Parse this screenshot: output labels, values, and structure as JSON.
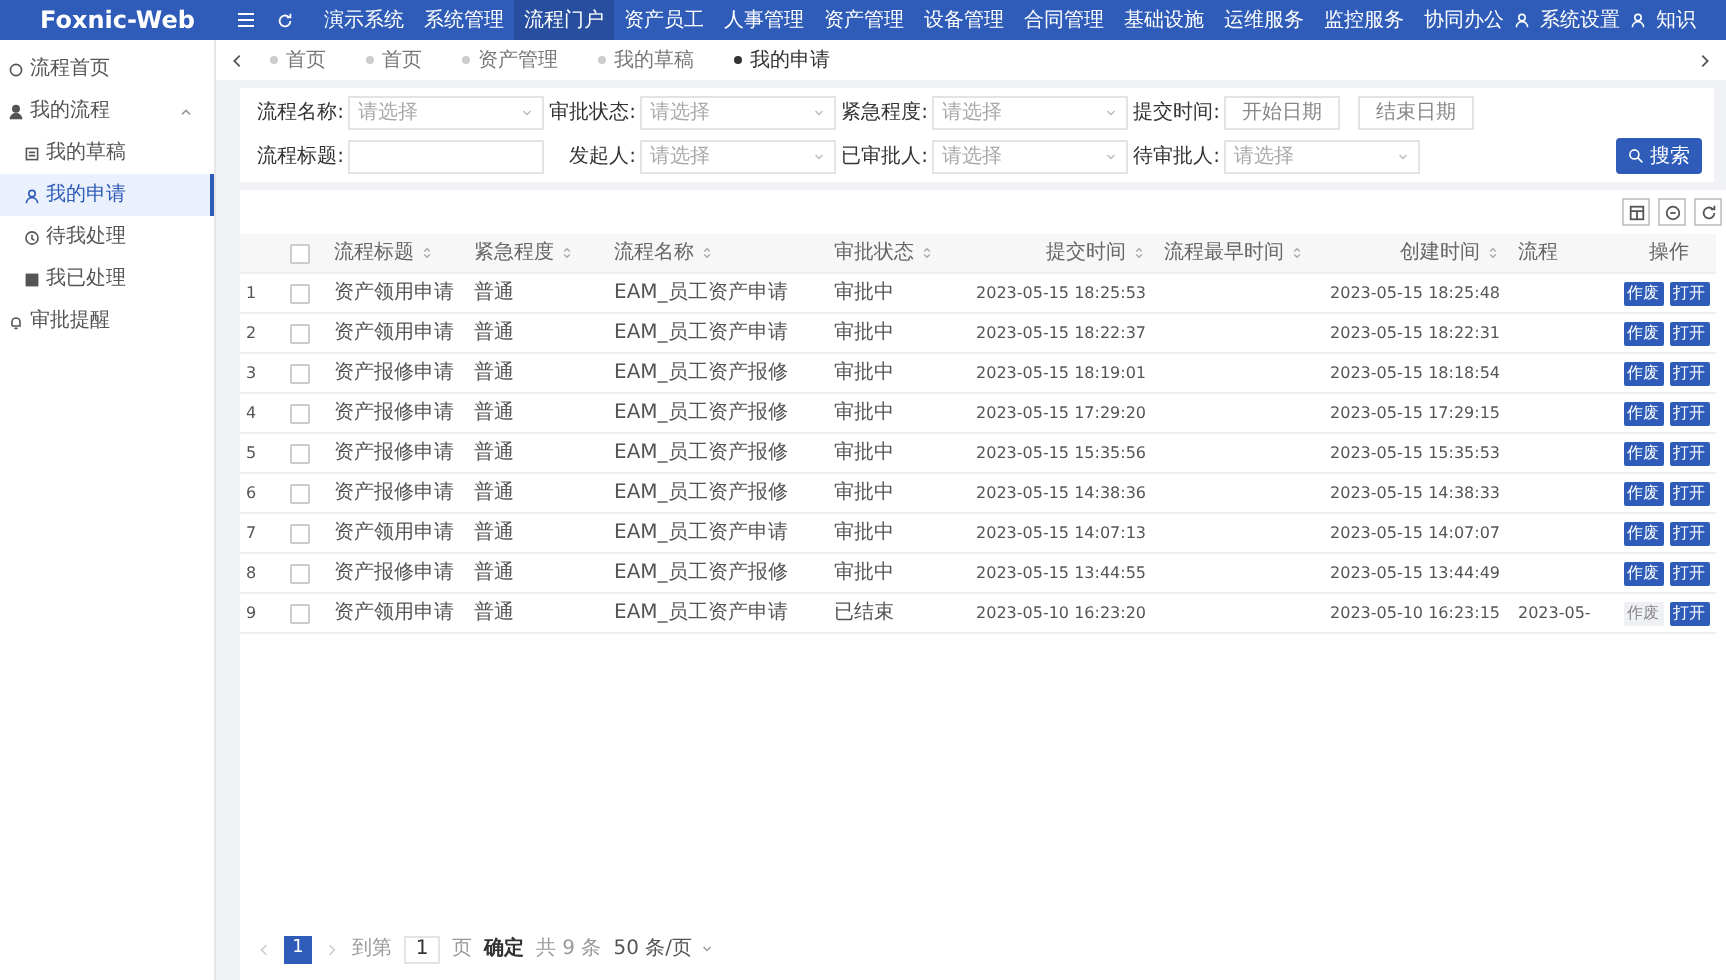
{
  "app": {
    "logo": "Foxnic-Web"
  },
  "nav": [
    {
      "label": "演示系统",
      "selected": false
    },
    {
      "label": "系统管理",
      "selected": false
    },
    {
      "label": "流程门户",
      "selected": true
    },
    {
      "label": "资产员工",
      "selected": false
    },
    {
      "label": "人事管理",
      "selected": false
    },
    {
      "label": "资产管理",
      "selected": false
    },
    {
      "label": "设备管理",
      "selected": false
    },
    {
      "label": "合同管理",
      "selected": false
    },
    {
      "label": "基础设施",
      "selected": false
    },
    {
      "label": "运维服务",
      "selected": false
    },
    {
      "label": "监控服务",
      "selected": false
    },
    {
      "label": "协同办公",
      "selected": false
    },
    {
      "label": "系统设置",
      "selected": false
    },
    {
      "label": "知识",
      "selected": false
    }
  ],
  "sidebar": [
    {
      "label": "流程首页",
      "selected": false
    },
    {
      "label": "我的流程",
      "selected": false,
      "expanded": true,
      "children": [
        {
          "label": "我的草稿",
          "selected": false
        },
        {
          "label": "我的申请",
          "selected": true
        },
        {
          "label": "待我处理",
          "selected": false
        },
        {
          "label": "我已处理",
          "selected": false
        }
      ]
    },
    {
      "label": "审批提醒",
      "selected": false
    }
  ],
  "tabs": [
    {
      "label": "首页",
      "selected": false
    },
    {
      "label": "首页",
      "selected": false
    },
    {
      "label": "资产管理",
      "selected": false
    },
    {
      "label": "我的草稿",
      "selected": false
    },
    {
      "label": "我的申请",
      "selected": true
    }
  ],
  "filters": [
    {
      "kind": "select",
      "label": "流程名称:",
      "placeholder": "请选择"
    },
    {
      "kind": "select",
      "label": "审批状态:",
      "placeholder": "请选择"
    },
    {
      "kind": "select",
      "label": "紧急程度:",
      "placeholder": "请选择"
    },
    {
      "kind": "daterange",
      "label": "提交时间:",
      "placeholder": "开始日期",
      "placeholder_end": "结束日期"
    },
    {
      "kind": "input",
      "label": "流程标题:"
    },
    {
      "kind": "select",
      "label": "发起人:",
      "placeholder": "请选择"
    },
    {
      "kind": "select",
      "label": "已审批人:",
      "placeholder": "请选择"
    },
    {
      "kind": "select",
      "label": "待审批人:",
      "placeholder": "请选择"
    }
  ],
  "search_button": "搜索",
  "table": {
    "header_checked": false,
    "columns": [
      {
        "label": "流程标题",
        "sortable": true
      },
      {
        "label": "紧急程度",
        "sortable": true
      },
      {
        "label": "流程名称",
        "sortable": true
      },
      {
        "label": "审批状态",
        "sortable": true
      },
      {
        "label": "提交时间",
        "sortable": true
      },
      {
        "label": "流程最早时间",
        "sortable": true
      },
      {
        "label": "创建时间",
        "sortable": true
      },
      {
        "label": "流程",
        "sortable": false
      },
      {
        "label": "操作",
        "sortable": false
      }
    ],
    "rows": [
      {
        "index": "1",
        "checked": false,
        "title": "资产领用申请",
        "urgency": "普通",
        "process": "EAM_员工资产申请",
        "status": "审批中",
        "submitted": "2023-05-15 18:25:53",
        "created": "2023-05-15 18:25:48",
        "actions": [
          {
            "label": "作废",
            "disabled": false
          },
          {
            "label": "打开",
            "disabled": false
          }
        ]
      },
      {
        "index": "2",
        "checked": false,
        "title": "资产领用申请",
        "urgency": "普通",
        "process": "EAM_员工资产申请",
        "status": "审批中",
        "submitted": "2023-05-15 18:22:37",
        "created": "2023-05-15 18:22:31",
        "actions": [
          {
            "label": "作废",
            "disabled": false
          },
          {
            "label": "打开",
            "disabled": false
          }
        ]
      },
      {
        "index": "3",
        "checked": false,
        "title": "资产报修申请",
        "urgency": "普通",
        "process": "EAM_员工资产报修",
        "status": "审批中",
        "submitted": "2023-05-15 18:19:01",
        "created": "2023-05-15 18:18:54",
        "actions": [
          {
            "label": "作废",
            "disabled": false
          },
          {
            "label": "打开",
            "disabled": false
          }
        ]
      },
      {
        "index": "4",
        "checked": false,
        "title": "资产报修申请",
        "urgency": "普通",
        "process": "EAM_员工资产报修",
        "status": "审批中",
        "submitted": "2023-05-15 17:29:20",
        "created": "2023-05-15 17:29:15",
        "actions": [
          {
            "label": "作废",
            "disabled": false
          },
          {
            "label": "打开",
            "disabled": false
          }
        ]
      },
      {
        "index": "5",
        "checked": false,
        "title": "资产报修申请",
        "urgency": "普通",
        "process": "EAM_员工资产报修",
        "status": "审批中",
        "submitted": "2023-05-15 15:35:56",
        "created": "2023-05-15 15:35:53",
        "actions": [
          {
            "label": "作废",
            "disabled": false
          },
          {
            "label": "打开",
            "disabled": false
          }
        ]
      },
      {
        "index": "6",
        "checked": false,
        "title": "资产报修申请",
        "urgency": "普通",
        "process": "EAM_员工资产报修",
        "status": "审批中",
        "submitted": "2023-05-15 14:38:36",
        "created": "2023-05-15 14:38:33",
        "actions": [
          {
            "label": "作废",
            "disabled": false
          },
          {
            "label": "打开",
            "disabled": false
          }
        ]
      },
      {
        "index": "7",
        "checked": false,
        "title": "资产领用申请",
        "urgency": "普通",
        "process": "EAM_员工资产申请",
        "status": "审批中",
        "submitted": "2023-05-15 14:07:13",
        "created": "2023-05-15 14:07:07",
        "actions": [
          {
            "label": "作废",
            "disabled": false
          },
          {
            "label": "打开",
            "disabled": false
          }
        ]
      },
      {
        "index": "8",
        "checked": false,
        "title": "资产报修申请",
        "urgency": "普通",
        "process": "EAM_员工资产报修",
        "status": "审批中",
        "submitted": "2023-05-15 13:44:55",
        "created": "2023-05-15 13:44:49",
        "actions": [
          {
            "label": "作废",
            "disabled": false
          },
          {
            "label": "打开",
            "disabled": false
          }
        ]
      },
      {
        "index": "9",
        "checked": false,
        "title": "资产领用申请",
        "urgency": "普通",
        "process": "EAM_员工资产申请",
        "status": "已结束",
        "submitted": "2023-05-10 16:23:20",
        "created": "2023-05-10 16:23:15",
        "column_9": "2023-05-",
        "actions": [
          {
            "label": "作废",
            "disabled": true
          },
          {
            "label": "打开",
            "disabled": false
          }
        ]
      }
    ]
  },
  "pagination": {
    "pages": [
      {
        "label": "1",
        "selected": true
      }
    ],
    "goto_label": "到第",
    "goto_value": "1",
    "page_unit": "页",
    "confirm": "确定",
    "total": "共 9 条",
    "page_size": "50 条/页"
  }
}
